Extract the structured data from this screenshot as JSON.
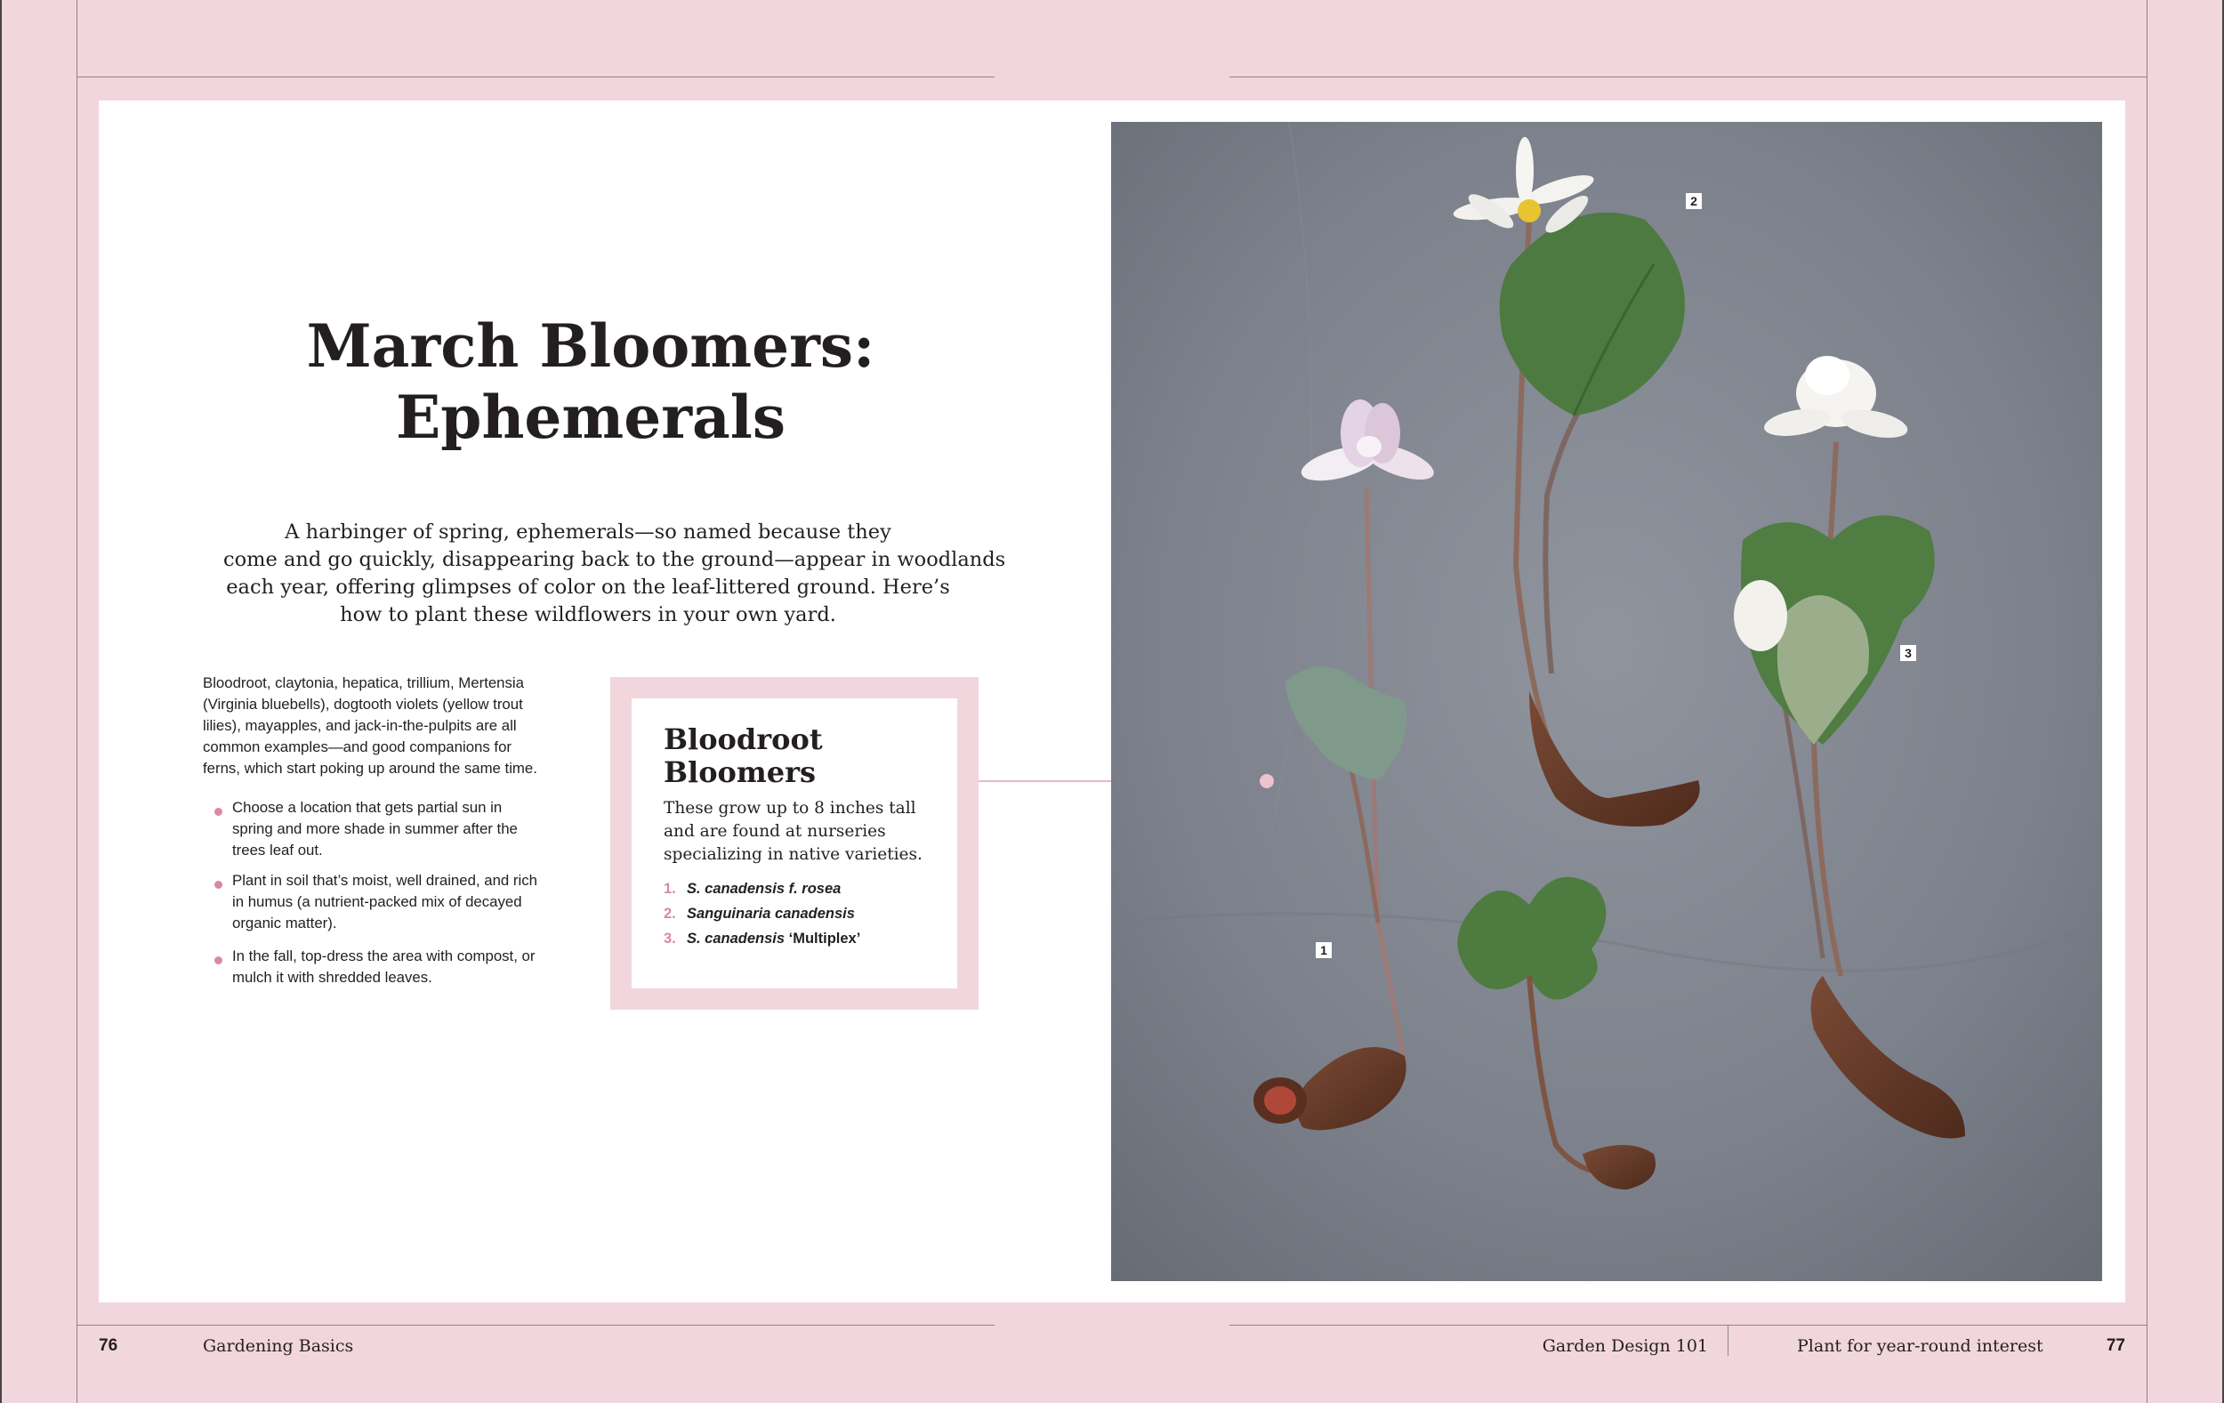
{
  "title": {
    "line1": "March Bloomers:",
    "line2": "Ephemerals"
  },
  "intro": [
    "A harbinger of spring, ephemerals—so named because they",
    "come and go quickly, disappearing back to the ground—appear in woodlands",
    "each year, offering glimpses of color on the leaf-littered ground. Here’s",
    "how to plant these wildflowers in your own yard."
  ],
  "body": [
    "Bloodroot, claytonia, hepatica, trillium, Mertensia",
    "(Virginia bluebells), dogtooth violets (yellow trout",
    "lilies), mayapples, and jack-in-the-pulpits are all",
    "common examples—and good companions for",
    "ferns, which start poking up around the same time."
  ],
  "bullets": [
    [
      "Choose a location that gets partial sun in",
      "spring and more shade in summer after the",
      "trees leaf out."
    ],
    [
      "Plant in soil that’s moist, well drained, and rich",
      "in humus (a nutrient-packed mix of decayed",
      "organic matter)."
    ],
    [
      "In the fall, top-dress the area with compost, or",
      "mulch it with shredded leaves."
    ]
  ],
  "sidebar": {
    "title": [
      "Bloodroot",
      "Bloomers"
    ],
    "body": [
      "These grow up to 8 inches tall",
      "and are found at nurseries",
      "specializing in native varieties."
    ],
    "items": [
      {
        "num": "1.",
        "name": "S. canadensis f. rosea",
        "suffix": ""
      },
      {
        "num": "2.",
        "name": "Sanguinaria canadensis",
        "suffix": ""
      },
      {
        "num": "3.",
        "name": "S. canadensis ",
        "suffix": "‘Multiplex’"
      }
    ]
  },
  "photo": {
    "labels": [
      "1",
      "2",
      "3"
    ],
    "description_icon": "bloodroot-photo"
  },
  "footer": {
    "left_page": "76",
    "left_section": "Gardening Basics",
    "right_book": "Garden Design 101",
    "right_chapter": "Plant for year-round interest",
    "right_page": "77"
  },
  "colors": {
    "page_background": "#f2d6dd",
    "accent_pink": "#d98a9e",
    "text": "#231f20"
  }
}
